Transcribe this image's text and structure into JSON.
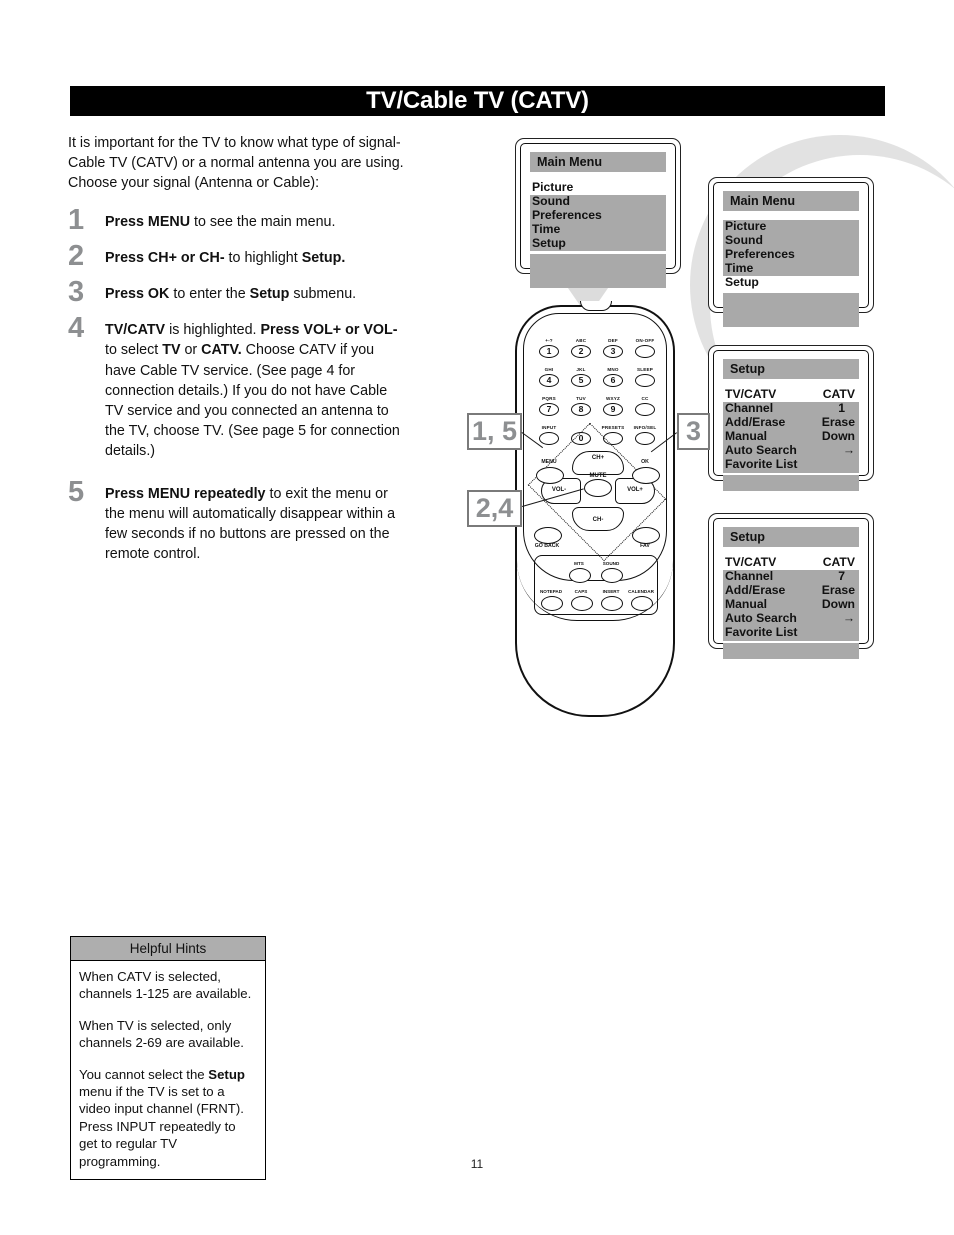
{
  "page": {
    "title": "TV/Cable TV (CATV)",
    "number": "11"
  },
  "intro": "It is important for the TV to know what type of signal-Cable TV (CATV) or a normal antenna you are using. Choose your signal (Antenna or Cable):",
  "steps": [
    {
      "num": "1",
      "html": "<b>Press MENU</b> to see the main menu."
    },
    {
      "num": "2",
      "html": "<b>Press CH+ or CH-</b> to highlight <b>Setup.</b>"
    },
    {
      "num": "3",
      "html": "<b>Press OK</b> to enter the <b>Setup</b> submenu."
    },
    {
      "num": "4",
      "html": "<b>TV/CATV</b> is highlighted. <b>Press VOL+ or VOL-</b> to select <b>TV</b> or <b>CATV.</b> Choose CATV if you have Cable TV service. (See page 4 for connection details.) If you do not have Cable TV service and you connected an antenna to the TV, choose TV. (See page 5 for connection details.)"
    },
    {
      "num": "5",
      "html": "<b>Press MENU repeatedly</b> to exit the menu or the menu will automatically disappear within a few seconds if no buttons are pressed on the remote control."
    }
  ],
  "hints": {
    "header": "Helpful Hints",
    "paragraphs": [
      "When CATV is selected, channels 1-125 are available.",
      "When TV is selected, only channels 2-69 are available.",
      "You cannot select the <b>Setup</b> menu if the TV is set to a video input channel (FRNT). Press INPUT repeatedly to get to regular TV programming."
    ]
  },
  "screens": [
    {
      "id": "screen1",
      "title": "Main Menu",
      "rows": [
        {
          "label": "Picture",
          "value": "",
          "highlighted": true
        },
        {
          "label": "Sound",
          "value": "",
          "highlighted": false
        },
        {
          "label": "Preferences",
          "value": "",
          "highlighted": false
        },
        {
          "label": "Time",
          "value": "",
          "highlighted": false
        },
        {
          "label": "Setup",
          "value": "",
          "highlighted": false
        }
      ]
    },
    {
      "id": "screen2",
      "title": "Main Menu",
      "rows": [
        {
          "label": "Picture",
          "value": "",
          "highlighted": false
        },
        {
          "label": "Sound",
          "value": "",
          "highlighted": false
        },
        {
          "label": "Preferences",
          "value": "",
          "highlighted": false
        },
        {
          "label": "Time",
          "value": "",
          "highlighted": false
        },
        {
          "label": "Setup",
          "value": "",
          "highlighted": true
        }
      ]
    },
    {
      "id": "screen3",
      "title": "Setup",
      "rows": [
        {
          "label": "TV/CATV",
          "value": "CATV",
          "highlighted": true
        },
        {
          "label": "Channel",
          "value": "1",
          "highlighted": false
        },
        {
          "label": "Add/Erase",
          "value": "Erase",
          "highlighted": false
        },
        {
          "label": "Manual",
          "value": "Down",
          "highlighted": false
        },
        {
          "label": "Auto Search",
          "value": "→",
          "highlighted": false
        },
        {
          "label": "Favorite List",
          "value": "",
          "highlighted": false
        }
      ]
    },
    {
      "id": "screen4",
      "title": "Setup",
      "rows": [
        {
          "label": "TV/CATV",
          "value": "CATV",
          "highlighted": true
        },
        {
          "label": "Channel",
          "value": "7",
          "highlighted": false
        },
        {
          "label": "Add/Erase",
          "value": "Erase",
          "highlighted": false
        },
        {
          "label": "Manual",
          "value": "Down",
          "highlighted": false
        },
        {
          "label": "Auto Search",
          "value": "→",
          "highlighted": false
        },
        {
          "label": "Favorite List",
          "value": "",
          "highlighted": false
        }
      ]
    }
  ],
  "callouts": {
    "menu": "1, 5",
    "vol": "2,4",
    "ok": "3"
  },
  "remote": {
    "keypad": [
      {
        "digit": "1",
        "label": "+-?"
      },
      {
        "digit": "2",
        "label": "ABC"
      },
      {
        "digit": "3",
        "label": "DEF"
      },
      {
        "digit": "",
        "label": "ON-OFF"
      },
      {
        "digit": "4",
        "label": "GHI"
      },
      {
        "digit": "5",
        "label": "JKL"
      },
      {
        "digit": "6",
        "label": "MNO"
      },
      {
        "digit": "",
        "label": "SLEEP"
      },
      {
        "digit": "7",
        "label": "PQRS"
      },
      {
        "digit": "8",
        "label": "TUV"
      },
      {
        "digit": "9",
        "label": "WXYZ"
      },
      {
        "digit": "",
        "label": "CC"
      },
      {
        "digit": "",
        "label": "INPUT"
      },
      {
        "digit": "0",
        "label": ""
      },
      {
        "digit": "",
        "label": "PRESETS"
      },
      {
        "digit": "",
        "label": "INFO/SEL"
      }
    ],
    "nav": {
      "up": "CH+",
      "down": "CH-",
      "left": "VOL-",
      "right": "VOL+",
      "center": "MUTE"
    },
    "menu_key": "MENU",
    "ok_key": "OK",
    "go_back_key": "GO BACK",
    "fav_key": "FAV",
    "panel_keys": [
      "MTS",
      "SOUND",
      "NOTEPAD",
      "CAPS",
      "INSERT",
      "CALENDAR"
    ]
  },
  "colors": {
    "title_bar": "#000000",
    "menu_gray": "#a9a9a9",
    "hint_header_gray": "#aeaeae",
    "step_number_gray": "#8d8f91",
    "swoosh_gray": "#e2e2e2"
  }
}
